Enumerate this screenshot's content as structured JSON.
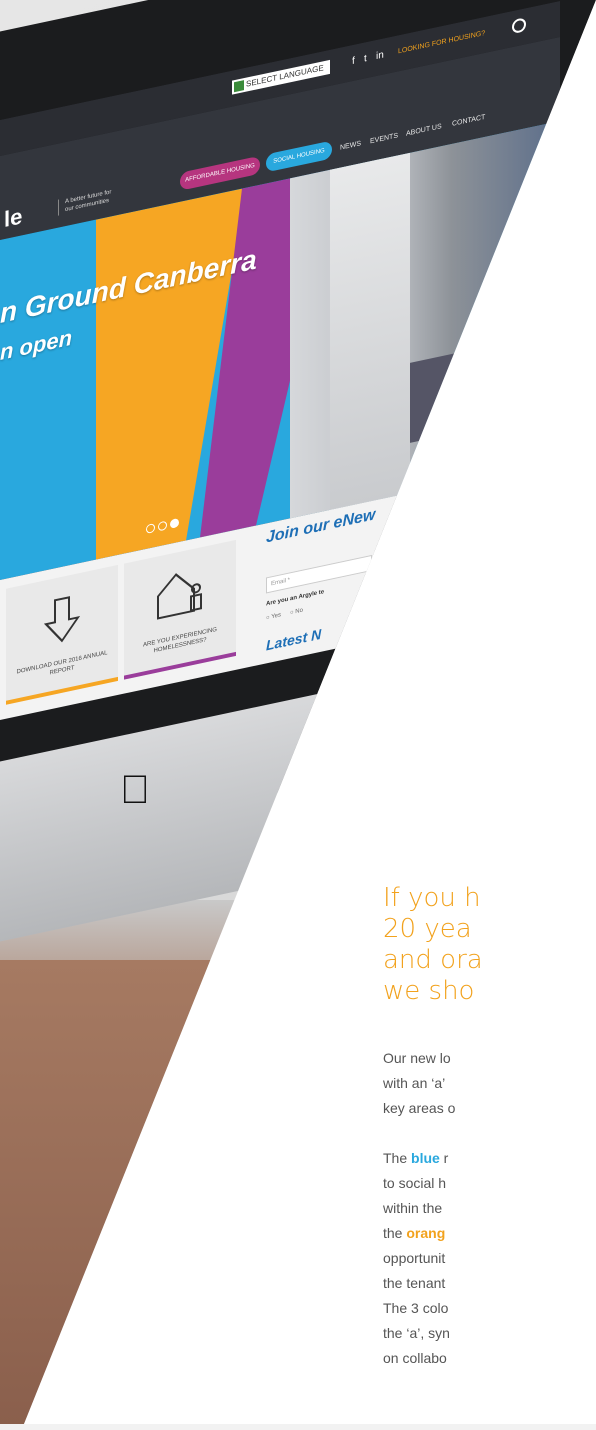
{
  "website": {
    "topbar": {
      "language_label": "SELECT LANGUAGE",
      "social_icons": [
        "f",
        "t",
        "in"
      ],
      "housing_link": "LOOKING FOR HOUSING?",
      "search_icon": "search-icon"
    },
    "navbar": {
      "logo_text": "le",
      "tagline": "A better future for our communities",
      "pill_affordable": "AFFORDABLE HOUSING",
      "pill_social": "SOCIAL HOUSING",
      "links": [
        "NEWS",
        "EVENTS",
        "ABOUT US",
        "CONTACT"
      ],
      "pill_colors": {
        "affordable": "#b6357f",
        "social": "#29a8de"
      }
    },
    "hero": {
      "line1": "n Ground Canberra",
      "line2": "n open",
      "slide_count": 3,
      "active_slide": 3
    },
    "cards": [
      {
        "icon": "download-arrow-icon",
        "label": "DOWNLOAD OUR 2016 ANNUAL REPORT",
        "accent": "#f6a623"
      },
      {
        "icon": "house-person-icon",
        "label": "ARE YOU EXPERIENCING HOMELESSNESS?",
        "accent": "#9a3d9b"
      }
    ],
    "newsletter": {
      "title": "Join our eNew",
      "email_placeholder": "Email *",
      "question": "Are you an Argyle te",
      "options": [
        "Yes",
        "No"
      ],
      "latest": "Latest N"
    }
  },
  "article": {
    "headline": [
      "If you h",
      "20 yea",
      "and ora",
      "we sho"
    ],
    "para1": [
      "Our new lo",
      "with an ‘a’",
      "key areas o"
    ],
    "para2_prefix": "The ",
    "para2_blue": "blue",
    "para2_after": " r",
    "para2_lines": [
      "to social h",
      "within the "
    ],
    "para2_prefix2": "the ",
    "para2_orange": "orang",
    "para2_lines2": [
      "opportunit",
      "the tenant",
      "The 3 colo",
      "the ‘a’, syn",
      "on collabo"
    ]
  },
  "colors": {
    "blue": "#29a8de",
    "orange": "#f2a21d",
    "purple": "#9a3d9b"
  }
}
